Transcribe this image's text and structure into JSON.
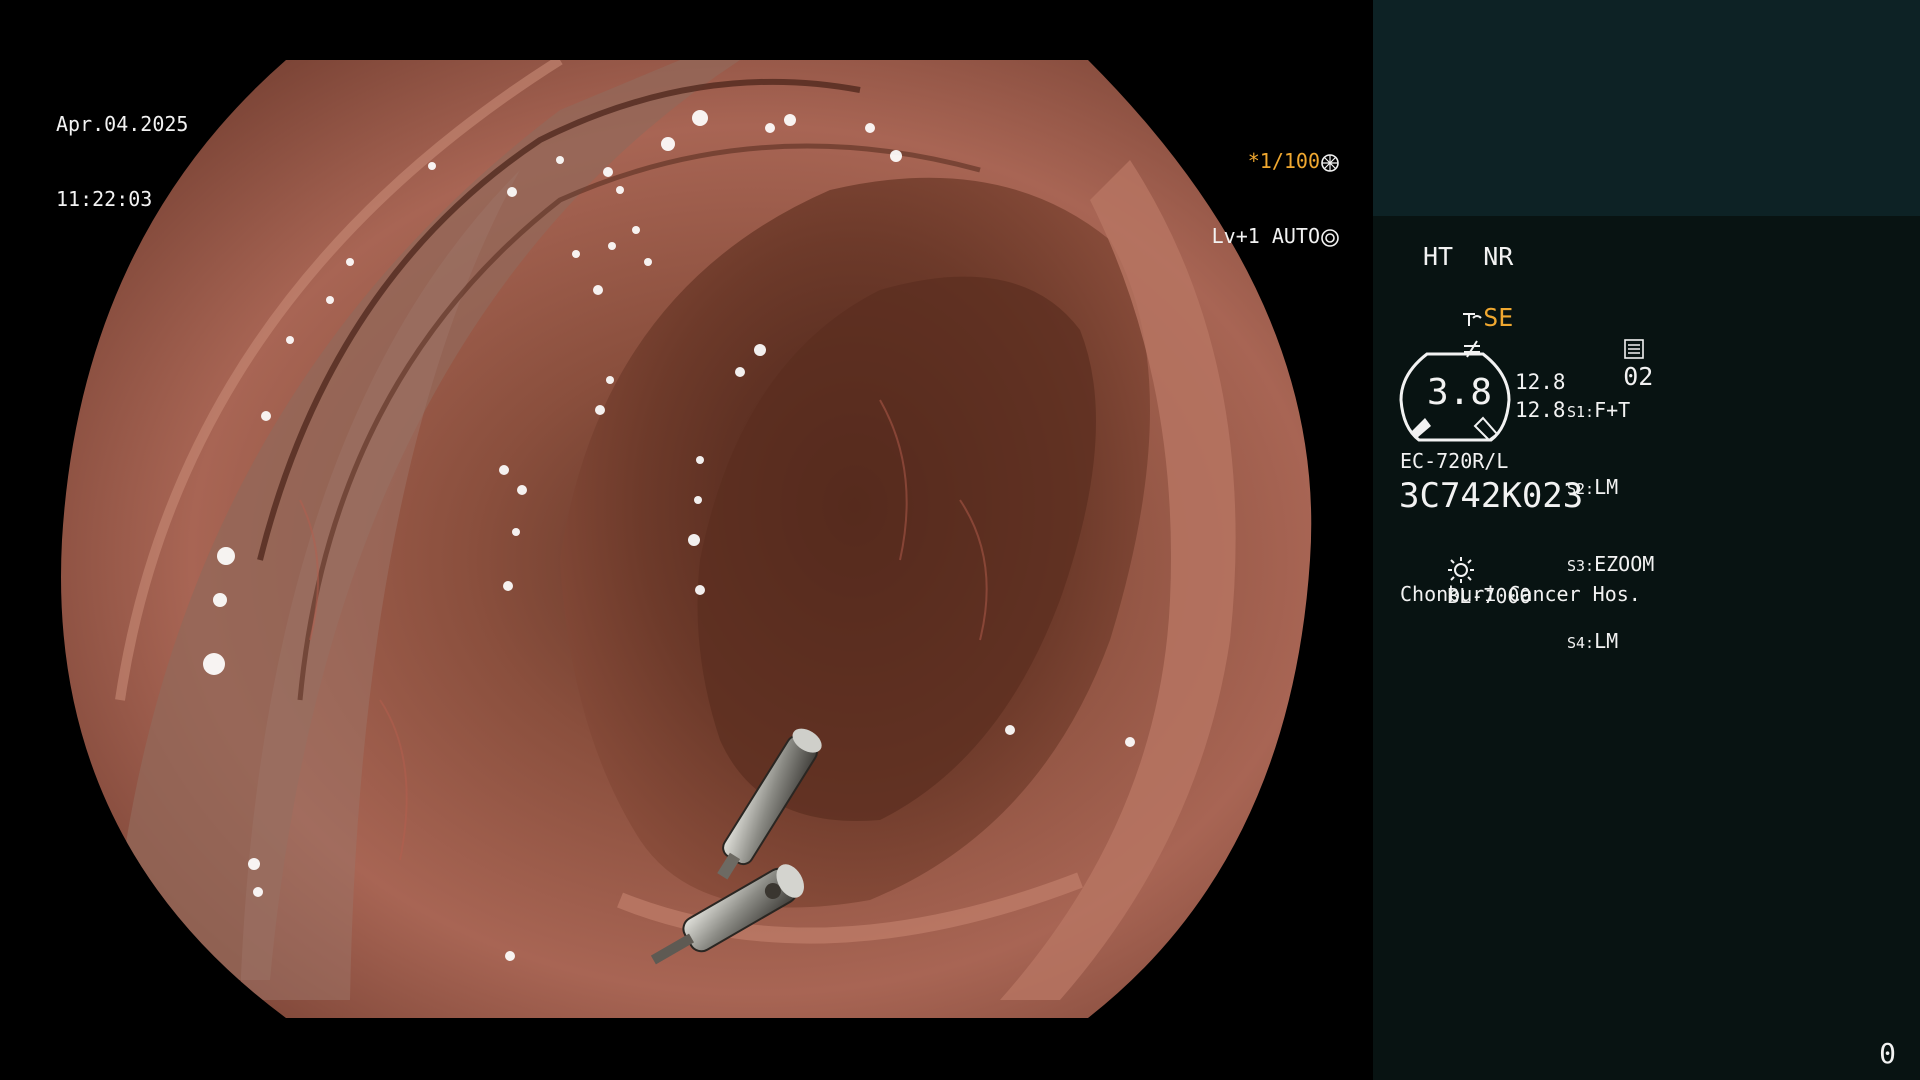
{
  "header": {
    "date": "Apr.04.2025",
    "time": "11:22:03",
    "shutter": "*1/100",
    "iris": "Lv+1 AUTO"
  },
  "panel": {
    "mode_ht_nr": "HT  NR",
    "mode_se": "SE",
    "memory_number": "02",
    "gauge_value": "3.8",
    "gauge_val_top": "12.8",
    "gauge_val_bottom": "12.8",
    "switches": [
      {
        "key": "S1:",
        "value": "F+T"
      },
      {
        "key": "S2:",
        "value": "LM"
      },
      {
        "key": "S3:",
        "value": "EZOOM"
      },
      {
        "key": "S4:",
        "value": "LM"
      }
    ],
    "scope_model": "EC-720R/L",
    "serial": "3C742K023",
    "light_source": "BL-7000",
    "hospital": "Chonburi Cancer Hos.",
    "counter": "0"
  },
  "colors": {
    "panel_bg": "#081312",
    "thumb_bg": "#0d2225",
    "accent_amber": "#f0a830",
    "text": "#f2f2f2"
  },
  "icons": [
    "aperture-icon",
    "iris-icon",
    "se-tool-icon",
    "enhance-icon",
    "memory-icon",
    "gauge-icon",
    "lamp-icon"
  ]
}
